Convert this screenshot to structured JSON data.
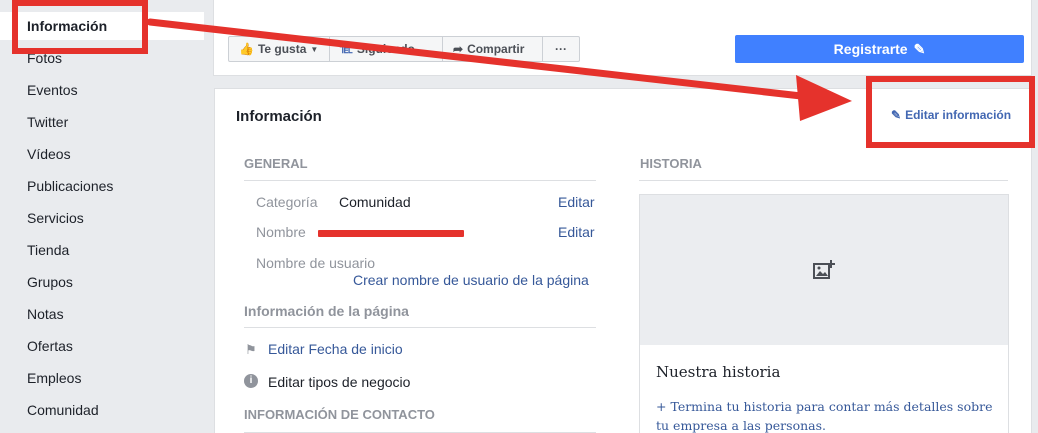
{
  "sidebar": {
    "items": [
      {
        "label": "Información",
        "active": true
      },
      {
        "label": "Fotos"
      },
      {
        "label": "Eventos"
      },
      {
        "label": "Twitter"
      },
      {
        "label": "Vídeos"
      },
      {
        "label": "Publicaciones"
      },
      {
        "label": "Servicios"
      },
      {
        "label": "Tienda"
      },
      {
        "label": "Grupos"
      },
      {
        "label": "Notas"
      },
      {
        "label": "Ofertas"
      },
      {
        "label": "Empleos"
      },
      {
        "label": "Comunidad"
      }
    ]
  },
  "topbar": {
    "like_label": "Te gusta",
    "follow_label": "Siguiendo",
    "share_label": "Compartir",
    "more_label": "···",
    "register_label": "Registrarte"
  },
  "card": {
    "title": "Información",
    "edit_link": "Editar información",
    "general": {
      "title": "GENERAL",
      "rows": [
        {
          "label": "Categoría",
          "value": "Comunidad",
          "action": "Editar"
        },
        {
          "label": "Nombre",
          "value": "",
          "action": "Editar"
        },
        {
          "label": "Nombre de usuario",
          "action": "Crear nombre de usuario de la página"
        }
      ]
    },
    "page_info": {
      "title": "Información de la página",
      "items": [
        {
          "icon": "flag-icon",
          "label": "Editar Fecha de inicio"
        },
        {
          "icon": "info-icon",
          "label": "Editar tipos de negocio"
        }
      ]
    },
    "contact": {
      "title": "INFORMACIÓN DE CONTACTO"
    },
    "history": {
      "title": "HISTORIA",
      "story_title": "Nuestra historia",
      "story_desc": "+ Termina tu historia para contar más detalles sobre tu empresa a las personas."
    }
  },
  "colors": {
    "accent": "#4267b2",
    "primary_button": "#4080ff",
    "annotation": "#e5322c"
  }
}
